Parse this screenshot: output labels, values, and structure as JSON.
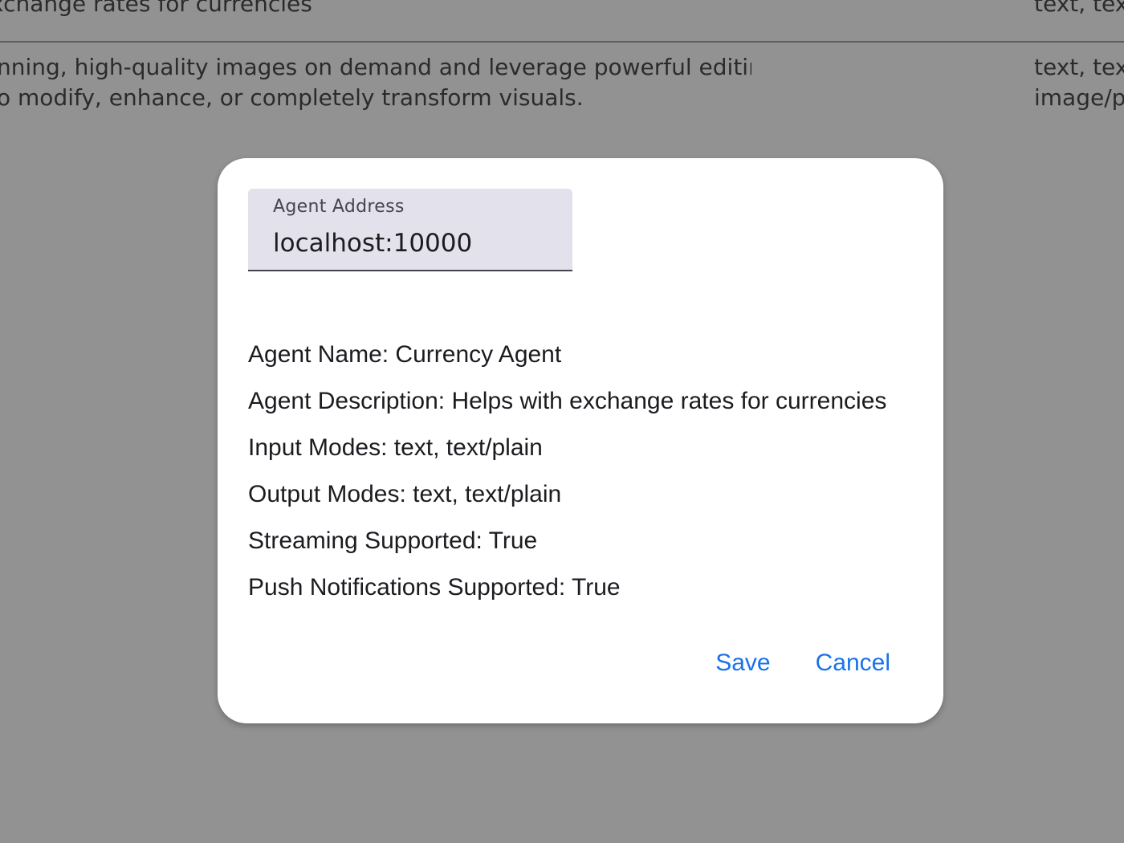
{
  "background": {
    "rows": [
      {
        "description_lines": [
          "xchange rates for currencies"
        ],
        "modes_lines": [
          "text, tex"
        ]
      },
      {
        "description_lines": [
          "nning, high-quality images on demand and leverage powerful editing",
          "o modify, enhance, or completely transform visuals."
        ],
        "modes_lines": [
          "text, tex",
          "image/p"
        ]
      }
    ]
  },
  "dialog": {
    "address_field": {
      "label": "Agent Address",
      "value": "localhost:10000"
    },
    "info": {
      "agent_name": "Agent Name: Currency Agent",
      "agent_description": "Agent Description: Helps with exchange rates for currencies",
      "input_modes": "Input Modes: text, text/plain",
      "output_modes": "Output Modes: text, text/plain",
      "streaming": "Streaming Supported: True",
      "push_notifications": "Push Notifications Supported: True"
    },
    "actions": {
      "save_label": "Save",
      "cancel_label": "Cancel"
    }
  },
  "colors": {
    "scrim": "#929293",
    "accent": "#1a73e8",
    "field_fill": "#e3e1ec"
  }
}
